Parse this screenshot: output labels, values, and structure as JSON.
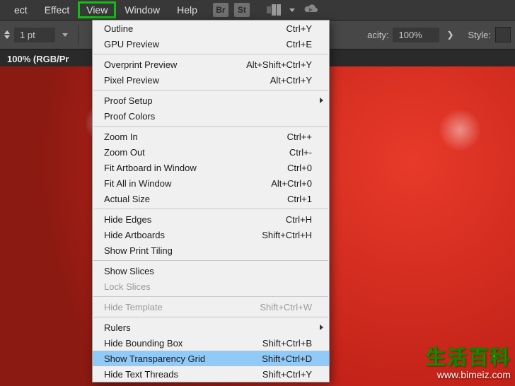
{
  "menubar": {
    "items": [
      "ect",
      "Effect",
      "View",
      "Window",
      "Help"
    ],
    "active_index": 2,
    "br_label": "Br",
    "st_label": "St"
  },
  "toolbar": {
    "stroke_value": "1 pt",
    "opacity_label": "acity:",
    "opacity_value": "100%",
    "style_label": "Style:"
  },
  "doc": {
    "title": " 100% (RGB/Pr"
  },
  "view_menu": [
    {
      "label": "Outline",
      "shortcut": "Ctrl+Y"
    },
    {
      "label": "GPU Preview",
      "shortcut": "Ctrl+E"
    },
    {
      "sep": true
    },
    {
      "label": "Overprint Preview",
      "shortcut": "Alt+Shift+Ctrl+Y"
    },
    {
      "label": "Pixel Preview",
      "shortcut": "Alt+Ctrl+Y"
    },
    {
      "sep": true
    },
    {
      "label": "Proof Setup",
      "submenu": true
    },
    {
      "label": "Proof Colors"
    },
    {
      "sep": true
    },
    {
      "label": "Zoom In",
      "shortcut": "Ctrl++"
    },
    {
      "label": "Zoom Out",
      "shortcut": "Ctrl+-"
    },
    {
      "label": "Fit Artboard in Window",
      "shortcut": "Ctrl+0"
    },
    {
      "label": "Fit All in Window",
      "shortcut": "Alt+Ctrl+0"
    },
    {
      "label": "Actual Size",
      "shortcut": "Ctrl+1"
    },
    {
      "sep": true
    },
    {
      "label": "Hide Edges",
      "shortcut": "Ctrl+H"
    },
    {
      "label": "Hide Artboards",
      "shortcut": "Shift+Ctrl+H"
    },
    {
      "label": "Show Print Tiling"
    },
    {
      "sep": true
    },
    {
      "label": "Show Slices"
    },
    {
      "label": "Lock Slices",
      "disabled": true
    },
    {
      "sep": true
    },
    {
      "label": "Hide Template",
      "shortcut": "Shift+Ctrl+W",
      "disabled": true
    },
    {
      "sep": true
    },
    {
      "label": "Rulers",
      "submenu": true
    },
    {
      "label": "Hide Bounding Box",
      "shortcut": "Shift+Ctrl+B"
    },
    {
      "label": "Show Transparency Grid",
      "shortcut": "Shift+Ctrl+D",
      "highlight": true
    },
    {
      "label": "Hide Text Threads",
      "shortcut": "Shift+Ctrl+Y"
    }
  ],
  "watermark": {
    "line1": "生活百科",
    "line2": "www.bimeiz.com"
  }
}
